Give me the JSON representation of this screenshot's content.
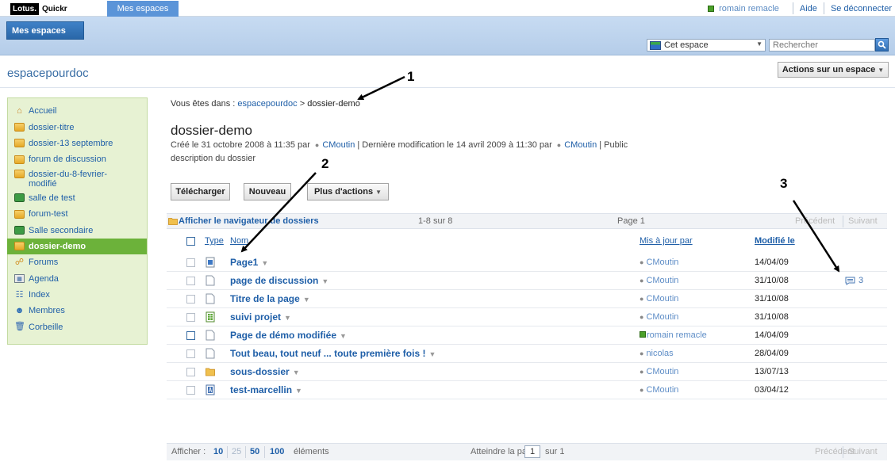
{
  "topbar": {
    "logo_box": "Lotus.",
    "logo_text": "Quickr",
    "tab": "Mes espaces",
    "user": "romain remacle",
    "help": "Aide",
    "logout": "Se déconnecter"
  },
  "navbar": {
    "tab": "Mes espaces",
    "scope": "Cet espace",
    "search_placeholder": "Rechercher"
  },
  "space": {
    "title": "espacepourdoc",
    "actions": "Actions sur un espace"
  },
  "sidebar": {
    "items": [
      {
        "label": "Accueil"
      },
      {
        "label": "dossier-titre"
      },
      {
        "label": "dossier-13 septembre"
      },
      {
        "label": "forum de discussion"
      },
      {
        "label": "dossier-du-8-fevrier-modifié"
      },
      {
        "label": "salle de test"
      },
      {
        "label": "forum-test"
      },
      {
        "label": "Salle secondaire"
      },
      {
        "label": "dossier-demo"
      },
      {
        "label": "Forums"
      },
      {
        "label": "Agenda"
      },
      {
        "label": "Index"
      },
      {
        "label": "Membres"
      },
      {
        "label": "Corbeille"
      }
    ]
  },
  "breadcrumb": {
    "prefix": "Vous êtes dans :",
    "space": "espacepourdoc",
    "sep": ">",
    "current": "dossier-demo"
  },
  "folder": {
    "title": "dossier-demo",
    "created": "Créé le 31 octobre 2008 à 11:35 par",
    "creator": "CMoutin",
    "modified": "| Dernière modification le 14 avril 2009 à 11:30 par",
    "modifier": "CMoutin",
    "visibility": "| Public",
    "description": "description du dossier"
  },
  "buttons": {
    "download": "Télécharger",
    "new": "Nouveau",
    "more": "Plus d'actions"
  },
  "infobar": {
    "browser": "Afficher le navigateur de dossiers",
    "count": "1-8 sur 8",
    "page": "Page 1",
    "prev": "Précédent",
    "next": "Suivant"
  },
  "table": {
    "col_type": "Type",
    "col_name": "Nom",
    "col_by": "Mis à jour par",
    "col_date": "Modifié le",
    "rows": [
      {
        "name": "Page1",
        "by": "CMoutin",
        "date": "14/04/09"
      },
      {
        "name": "page de discussion",
        "by": "CMoutin",
        "date": "31/10/08",
        "comments": "3"
      },
      {
        "name": "Titre de la page",
        "by": "CMoutin",
        "date": "31/10/08"
      },
      {
        "name": "suivi projet",
        "by": "CMoutin",
        "date": "31/10/08"
      },
      {
        "name": "Page de démo modifiée",
        "by": "romain remacle",
        "date": "14/04/09"
      },
      {
        "name": "Tout beau, tout neuf ... toute première fois !",
        "by": "nicolas",
        "date": "28/04/09"
      },
      {
        "name": "sous-dossier",
        "by": "CMoutin",
        "date": "13/07/13"
      },
      {
        "name": "test-marcellin",
        "by": "CMoutin",
        "date": "03/04/12"
      }
    ]
  },
  "footer": {
    "show": "Afficher :",
    "n10": "10",
    "n25": "25",
    "n50": "50",
    "n100": "100",
    "items": "éléments",
    "goto": "Atteindre la page",
    "page_value": "1",
    "of": "sur 1",
    "prev": "Précédent",
    "next": "Suivant"
  },
  "annotations": {
    "a1": "1",
    "a2": "2",
    "a3": "3"
  }
}
